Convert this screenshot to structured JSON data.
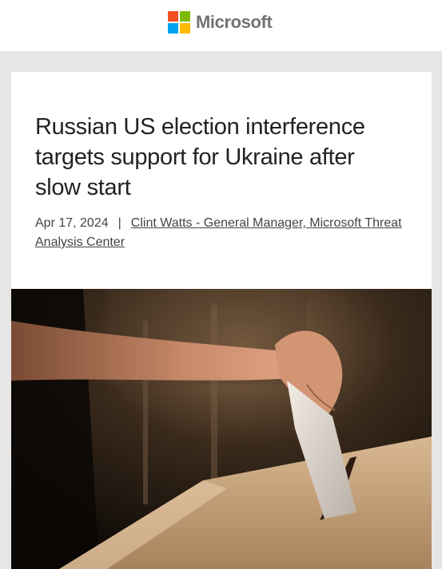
{
  "header": {
    "brand_name": "Microsoft",
    "logo_colors": [
      "#f25022",
      "#7fba00",
      "#00a4ef",
      "#ffb900"
    ]
  },
  "article": {
    "title": "Russian US election interference targets support for Ukraine after slow start",
    "date": "Apr 17, 2024",
    "separator": "|",
    "author": "Clint Watts - General Manager, Microsoft Threat Analysis Center"
  },
  "hero_image": {
    "subject": "hand-placing-ballot-into-box"
  }
}
